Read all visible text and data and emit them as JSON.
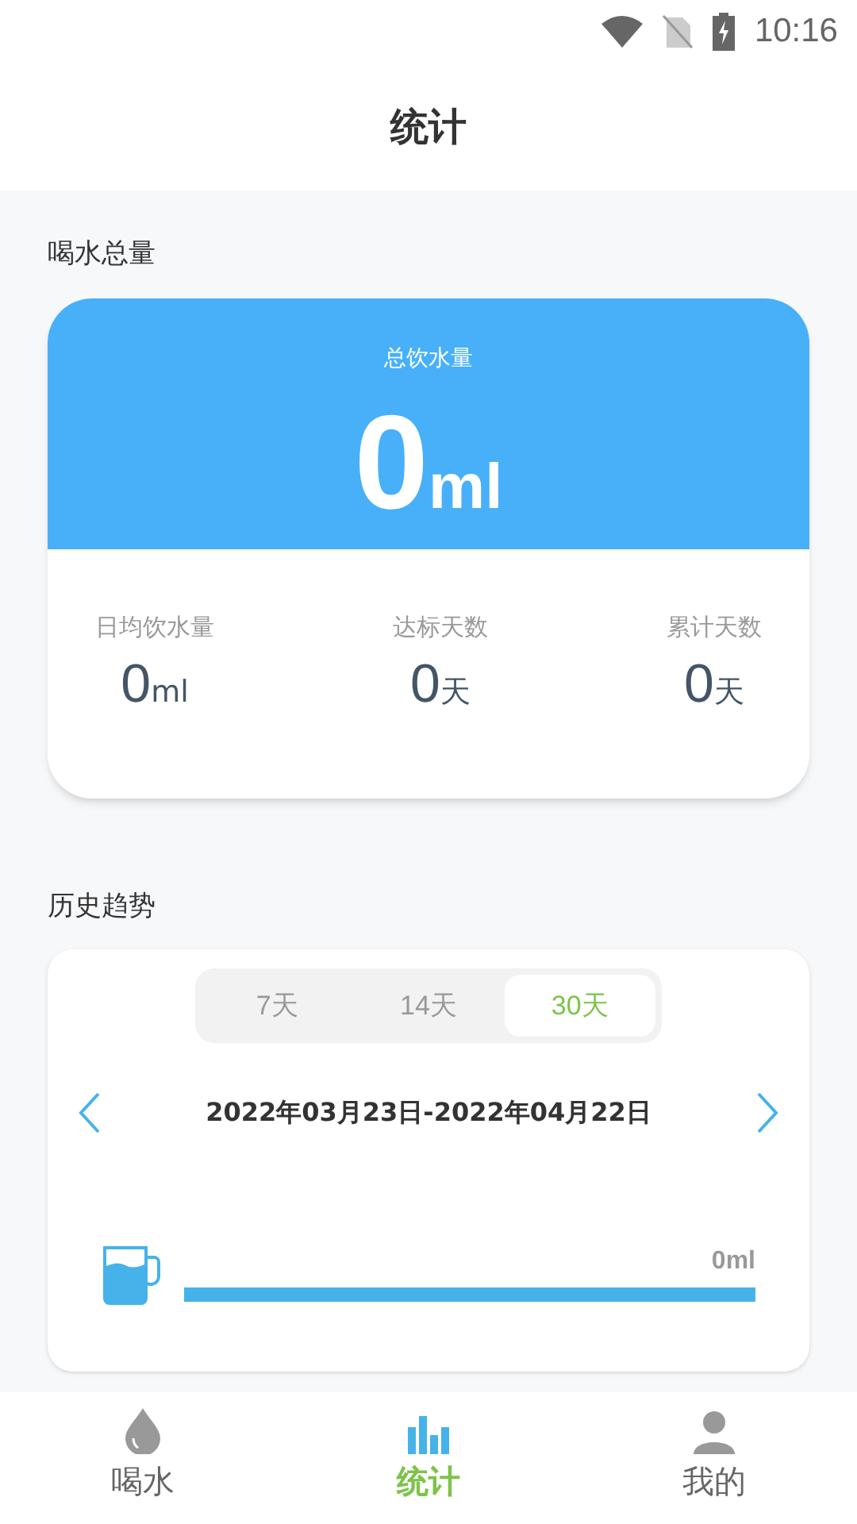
{
  "status_bar": {
    "time": "10:16"
  },
  "header": {
    "title": "统计"
  },
  "total_section": {
    "title": "喝水总量",
    "card": {
      "label": "总饮水量",
      "value": "0",
      "unit": "ml"
    },
    "stats": [
      {
        "label": "日均饮水量",
        "value": "0",
        "unit": "ml"
      },
      {
        "label": "达标天数",
        "value": "0",
        "unit": "天"
      },
      {
        "label": "累计天数",
        "value": "0",
        "unit": "天"
      }
    ]
  },
  "history_section": {
    "title": "历史趋势",
    "tabs": [
      {
        "label": "7天",
        "selected": false
      },
      {
        "label": "14天",
        "selected": false
      },
      {
        "label": "30天",
        "selected": true
      }
    ],
    "date_range": "2022年03月23日-2022年04月22日",
    "amount": "0ml"
  },
  "bottom_nav": [
    {
      "label": "喝水",
      "kind": "drop",
      "selected": false
    },
    {
      "label": "统计",
      "kind": "chart",
      "selected": true
    },
    {
      "label": "我的",
      "kind": "person",
      "selected": false
    }
  ]
}
